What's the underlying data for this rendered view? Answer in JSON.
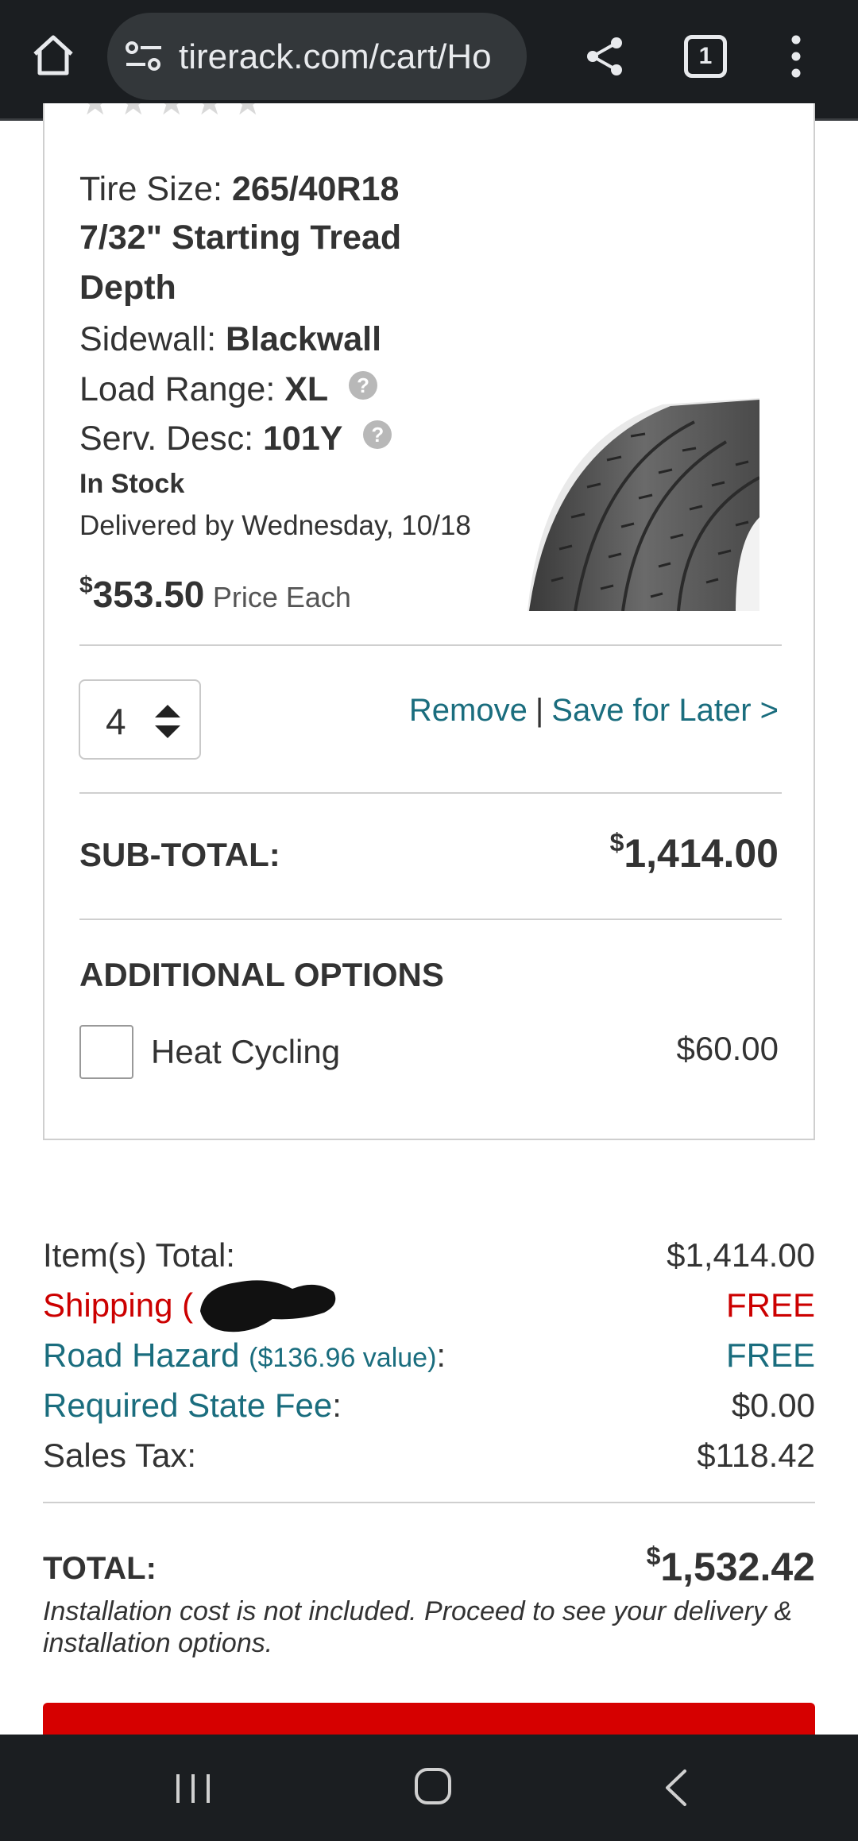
{
  "browser": {
    "url": "tirerack.com/cart/Ho",
    "tab_count": "1",
    "icons": {
      "home": "home-icon",
      "site_info": "tune-icon",
      "share": "share-icon",
      "tabs": "tab-switcher-icon",
      "menu": "more-vert-icon"
    }
  },
  "product": {
    "rating_stars": 5,
    "tire_size_label": "Tire Size:",
    "tire_size": "265/40R18",
    "tread_depth": "7/32\" Starting Tread Depth",
    "sidewall_label": "Sidewall:",
    "sidewall": "Blackwall",
    "load_range_label": "Load Range:",
    "load_range": "XL",
    "serv_desc_label": "Serv. Desc:",
    "serv_desc": "101Y",
    "help_glyph": "?",
    "stock_status": "In Stock",
    "delivery": "Delivered by Wednesday, 10/18",
    "price_currency": "$",
    "price": "353.50",
    "price_suffix": "Price Each"
  },
  "cart_item": {
    "quantity": "4",
    "remove_label": "Remove",
    "separator": "|",
    "save_for_later_label": "Save for Later >",
    "subtotal_label": "SUB-TOTAL:",
    "subtotal_currency": "$",
    "subtotal": "1,414.00",
    "additional_options_title": "ADDITIONAL OPTIONS",
    "option_heat_cycling_label": "Heat Cycling",
    "option_heat_cycling_price": "$60.00",
    "option_heat_cycling_checked": false
  },
  "summary": {
    "items_total_label": "Item(s) Total:",
    "items_total": "$1,414.00",
    "shipping_label": "Shipping (",
    "shipping_value": "FREE",
    "road_hazard_label": "Road Hazard",
    "road_hazard_note": "($136.96 value)",
    "road_hazard_colon": ":",
    "road_hazard_value": "FREE",
    "state_fee_label": "Required State Fee",
    "state_fee_colon": ":",
    "state_fee_value": "$0.00",
    "sales_tax_label": "Sales Tax:",
    "sales_tax_value": "$118.42",
    "total_label": "TOTAL:",
    "total_currency": "$",
    "total_value": "1,532.42",
    "install_note": "Installation cost is not included. Proceed to see your delivery & installation options."
  },
  "colors": {
    "accent_teal": "#1a6d7e",
    "alert_red": "#cc0000",
    "button_red": "#d60000",
    "system_bar": "#1b1e21"
  },
  "system_nav": {
    "recent": "recent-apps-icon",
    "home": "home-circle-icon",
    "back": "back-icon"
  }
}
